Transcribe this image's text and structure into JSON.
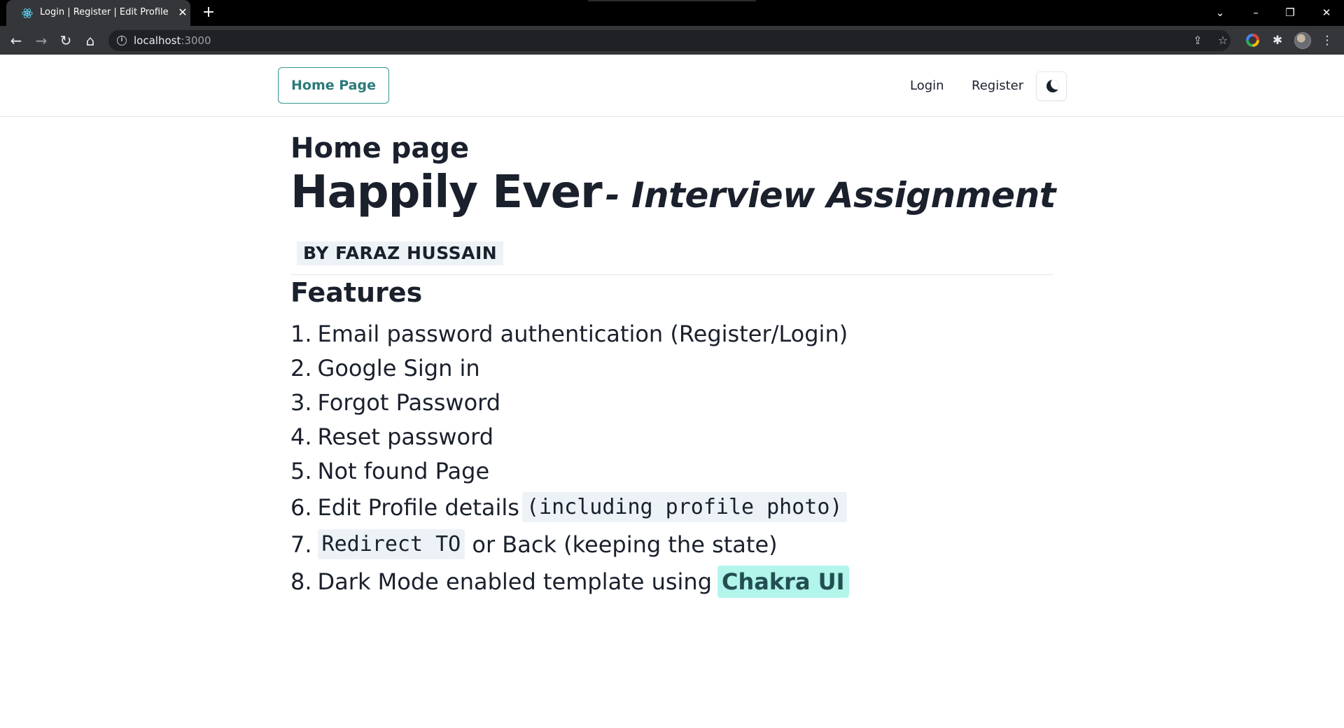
{
  "browser": {
    "tab_title": "Login | Register | Edit Profile",
    "tab_close": "✕",
    "new_tab": "+",
    "url_host": "localhost",
    "url_port": ":3000",
    "icons": {
      "back": "back-arrow-icon",
      "forward": "forward-arrow-icon",
      "reload": "reload-icon",
      "home": "home-icon",
      "share": "share-icon",
      "star": "bookmark-star-icon",
      "extensions": "puzzle-icon",
      "menu": "kebab-menu-icon"
    }
  },
  "navbar": {
    "home_label": "Home Page",
    "login_label": "Login",
    "register_label": "Register",
    "theme_toggle_icon": "moon-icon"
  },
  "main": {
    "page_title": "Home page",
    "hero_main": "Happily Ever",
    "hero_sub": "- Interview Assignment",
    "byline": "BY FARAZ HUSSAIN",
    "features_heading": "Features",
    "features": [
      {
        "num": "1.",
        "text": "Email password authentication (Register/Login)"
      },
      {
        "num": "2.",
        "text": "Google Sign in"
      },
      {
        "num": "3.",
        "text": "Forgot Password"
      },
      {
        "num": "4.",
        "text": "Reset password"
      },
      {
        "num": "5.",
        "text": "Not found Page"
      },
      {
        "num": "6.",
        "text": "Edit Profile details",
        "code": "(including profile photo)"
      },
      {
        "num": "7.",
        "code": "Redirect TO",
        "text": " or Back (keeping the state)"
      },
      {
        "num": "8.",
        "text": "Dark Mode enabled template using",
        "badge": "Chakra UI"
      }
    ]
  },
  "colors": {
    "accent": "#319795",
    "badge_bg": "#b2f5ea",
    "code_bg": "#edf2f7",
    "text": "#1a202c"
  }
}
